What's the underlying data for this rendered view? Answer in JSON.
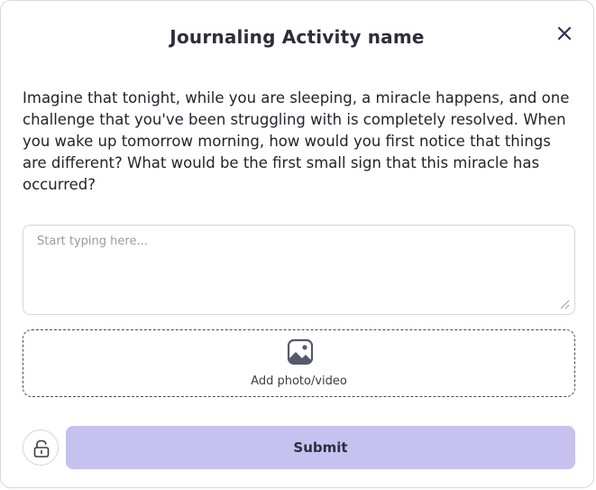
{
  "dialog": {
    "title": "Journaling Activity name",
    "close_icon": "close-icon"
  },
  "prompt": {
    "text": "Imagine that tonight, while you are sleeping, a miracle happens, and one challenge that you've been struggling with is completely resolved. When you wake up tomorrow morning, how would you first notice that things are different? What would be the first small sign that this miracle has occurred?"
  },
  "journal_input": {
    "value": "",
    "placeholder": "Start typing here..."
  },
  "upload": {
    "icon": "image-icon",
    "label": "Add photo/video"
  },
  "footer": {
    "lock_icon": "unlock-icon",
    "submit_label": "Submit"
  },
  "colors": {
    "submit_bg": "#c6c1ee",
    "title_text": "#2e2e3b",
    "close_icon": "#2c3457",
    "border": "#d6d6dc"
  }
}
